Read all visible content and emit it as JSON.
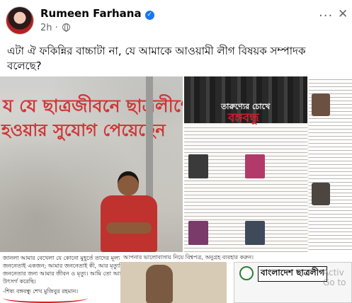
{
  "post": {
    "author": "Rumeen Farhana",
    "time": "2h",
    "meta_separator": "·",
    "caption": "এটা ঐ ফকিন্নির বাচ্চাটা না, যে আমাকে আওয়ামী লীগ বিষয়ক সম্পাদক বলেছে?"
  },
  "images": {
    "wall_graffiti_line1": "য যে ছাত্রজীবনে ছাত্রলীগের",
    "wall_graffiti_line2": "হওয়ার সুযোগ পেয়েছেন",
    "wall_caption": "জানলা আমার বেখেলা যে কোনো মুহূর্তে তাদের মূল্য হতে পারে। আমি জননেতাই একজন; আমার জননেতাই কী, আর মৃত্যুনিতী কী? আমার জননেতার জন্য আমার জীবন ও মৃত্যু। আমি তো আমার জীবন জননেতার জন্য উৎসর্গ করেছি।",
    "wall_caption_sign": "-শিষ্য বঙ্গবন্ধু শেখ মুজিবুর রহমান।",
    "newspaper_headline_a": "তারুণ্যের চোখে",
    "newspaper_headline_b": "বঙ্গবন্ধু",
    "bottom_strip": "আপনার ভালোবাসায় নিয়ে বিশ্বপত্র, অনুগ্রহ ব্যবহার করুন।",
    "card_title": "বাংলাদেশ ছাত্রলীগ"
  },
  "overlay": {
    "activate_line1": "Activ",
    "activate_line2": "Go to"
  },
  "icons": {
    "verified": "verified-badge-icon",
    "audience": "globe-icon",
    "more": "more-options-icon",
    "close": "close-icon"
  },
  "colors": {
    "verified_blue": "#1877f2",
    "secondary_text": "#65676b",
    "graffiti_red": "#d02a2a"
  }
}
